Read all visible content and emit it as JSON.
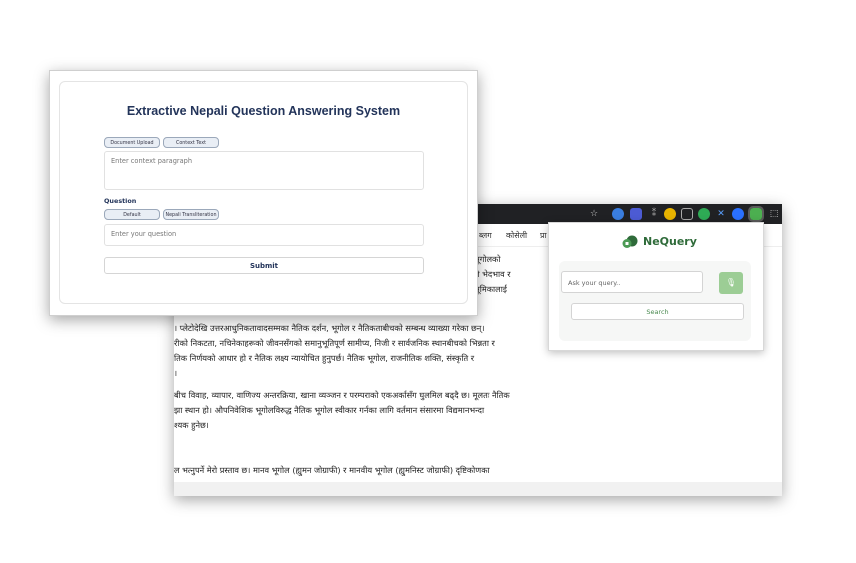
{
  "app": {
    "title": "Extractive Nepali Question Answering System",
    "context_tabs": [
      "Document Upload",
      "Context Text"
    ],
    "context_placeholder": "Enter context paragraph",
    "question_label": "Question",
    "question_tabs": [
      "Default",
      "Nepali Transliteration"
    ],
    "question_placeholder": "Enter your question",
    "submit_label": "Submit"
  },
  "browser": {
    "nav_links": [
      "ब्लग",
      "कोसेली",
      "प्रा"
    ],
    "article_lines": [
      "भूगोलको",
      "ले भेदभाव र",
      "भूमिकालाई",
      "। प्लेटोदेखि उत्तरआधुनिकतावादसम्मका नैतिक दर्शन, भूगोल र नैतिकताबीचको सम्बन्ध व्याख्या गरेका छन्।",
      "रीको निकटता, नचिनेकाहरूको जीवनसँगको समानुभूतिपूर्ण सामीप्य, निजी र सार्वजनिक स्थानबीचको भिन्नता र",
      "तिक निर्णयको आधार हो र नैतिक लक्ष्य न्यायोचित हुनुपर्छ। नैतिक भूगोल, राजनीतिक शक्ति, संस्कृति र",
      "।",
      "बीच विवाह, व्यापार, वाणिज्य अन्तरक्रिया, खाना व्यञ्जन र परम्पराको एकअर्कासँग घुलमिल बढ्दै छ। मूलतः नैतिक",
      "झा स्थान हो। औपनिवेशिक भूगोलविरुद्ध नैतिक भूगोल स्वीकार गर्नका लागि वर्तमान संसारमा विद्यमानभन्दा",
      "श्यक हुनेछ।",
      "ल भत्नुपर्ने मेरो प्रस्ताव छ। मानव भूगोल (ह्युमन जोग्राफी) र मानवीय भूगोल (ह्युमनिस्ट जोग्राफी) दृष्टिकोणका"
    ]
  },
  "popup": {
    "title": "NeQuery",
    "input_placeholder": "Ask your query..",
    "search_label": "Search"
  },
  "colors": {
    "brand_green": "#2f6b3a",
    "mic_green": "#9ccd95",
    "title_navy": "#23345a",
    "browser_dark": "#202124"
  }
}
